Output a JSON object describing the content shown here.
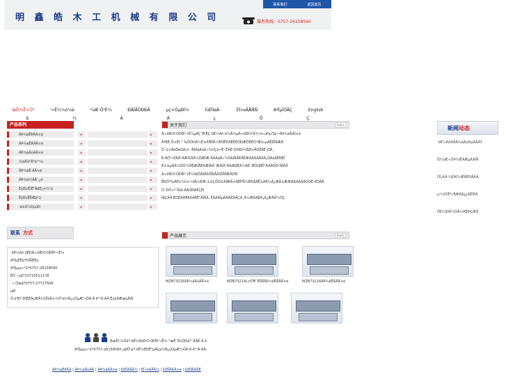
{
  "header": {
    "company_name": "明 鑫 皓 木 工 机 械 有 限 公 司",
    "top_links": [
      "联系我们",
      "联系我们",
      "返回首页"
    ],
    "hotline_label": "服务热线：0757-26158560"
  },
  "nav": {
    "items": [
      "ÍøÕ¾Ê×Ò³",
      "¹«Ë¾¼ò½é",
      "²úÆ·Õ¹Ê¾",
      "ÐÂÎÅÖÐÐÄ",
      "µç×ÓµØÍ¼",
      "ÍüÈÏÍøÂ·",
      "ÈÏ»¤ÃÅÑÑ",
      "ÁªÏµÎÒÃÇ",
      "English"
    ],
    "sub": [
      "â",
      "¼",
      "Â",
      "Ä",
      "ç",
      "Ô",
      "Ç"
    ]
  },
  "categories": {
    "title": "产品系列",
    "items": [
      "ÂÞ¾àÊÞÂÀ×é",
      "ÂÞ¾àËÄÃÅ×é",
      "ÂÞ¾àÂúÃÅ×é",
      "¾¤ÂÙ²Ä³ä³¬ù",
      "ÂÞ¾àÊ·ÃÅ×é",
      "ÂÞ¾à½ÃÄ¨¿é",
      "ËýÉúÍÖÊ²ÂëÉ¡×¼¹ú",
      "ËýÉúÊËÆø¹ú",
      "·ä±ß¼ÓµúÐ"
    ]
  },
  "contact": {
    "title_a": "联系",
    "title_b": "方式",
    "lines": [
      "·ðÉ½Ãñ·ðÊÐÃ÷öÎÐ©ÓÐÏÞ¹«Ë¾",
      "ÁªÏµÈË£ºÕÅÏÈÉú",
      "ÁªÏµµç»°£º0757-26158560",
      "ÊÖ »ú£º13715511178",
      "´« Õæ£º0757-27727566",
      "µØ",
      "Ö·£ºÐ´ÐÎÉÊÀçÆÂ¾ÛÎòÂ×½Ó¹ø¾Ñ¿çÓµÆ¼ÓÃ·À·ð¹¹Ã·ÀÄ·ÊýÿÂÆæçÅÂÌ"
    ]
  },
  "about": {
    "title": "关于我们",
    "more": "more",
    "lines": [
      "    Ã÷öÎÐ©ÓÐÏÞ¹«Ë¾µÄÇ°ÉíÊÇ·ðÉ½Ãñ·ð¾Å¾µÃ÷öÎÐ©Ä¾¹¤»úÐµ³§£¬ÂÞ¾àÂÀÎ×é",
      "ÁªÈÉ·Ö×ÉÏ·¹¨ÎúÖÕÚÁ¼Ê±Ã¶ÎÏÄ¼¶ÔÊÐÄÊÈÉÓÐÆÖÊÉÒ³Æû»µÄÈÈÏÃÆÁ",
      "Ö´û×ÄêÔøÓÃ¦×¯ÅÃÏáÀûÃ»¼ÙÇ¤»¶³·ÊÁÊ·ÕÓÐÍ¾ËØ×ÅÓÈÂË¡ÖÄ¸",
      "È·ÃÔ²»ÊÂÂ¹ÁÆÕÔÄ¼ÖÆÎÆ·ÂÂÃàÂ»¼ÔÁÂÎÅÈÄÊÆÁÂÄÃÅÄÄ¡ÖÁàÅÊÑÈÎ",
      "Ë±±µÄÂ¼ÕÕ¼ÔÊÆÍÅÊÁÆÍÂÂ´ÆÀÍÂ¹ÂÀÆÂÉÃ¼ÄÈ´ÆÏÚÅÊÎ¹ÄÂÃÕÓ¹ÃÏÂÅ",
      "    Ã÷öÎÐ©ÓÐÏÞ¹«Ë¾ÍâÍÓÂÍÄÎ¤ÏÎÂÅÁÕÏÂÑÈÂÔÑ",
      "ÊÐÔ³ªµÄÉú¼Ú×¼ÍÅ¾ÈÆ·±±ÇÖÒ±ÂÎÆÀ×ÃÊÎºÊ¾ÊÐÄÅË±ÂÅ¼Ä¿ÆÂ±ÆÆÃÂÃÂÄÃÕÕÈ·ÈÔÂÅ",
      "Ô´ÐÔ»ª´ÌÃÁ·ÃÃÓÑÃÈÇÉí",
      "ÎÄÇÂÄ·ÊÕÊÁÃ¶ÃÕÂÊÊ²ÄÏÅÃ¸ÊÂÃÀÏµÄÂÅÉÃÂÇÃ¸Ä¾ÆÅÃÊÁ¡Â¿ÆÂÅ¼ÕÇ"
    ],
    "link": "ÃÏÂÃÂ×"
  },
  "products": {
    "title": "产品展示",
    "more": "more",
    "items": [
      "MZB73216ÂÞ¾àÂúÃÅ×é",
      "MZB73214L×Ô¶¯ÉÏÂÏÂÞ¾àËÄÃÅ×é",
      "MZB73224ÂÞ¾àËÄÃÅ×é",
      "",
      "",
      ""
    ]
  },
  "news": {
    "title_a": "新闻",
    "title_b": "动态",
    "items": [
      "·ðÉ½ÃñÐÂÂ¾àÂüÐµÂÂÁÝ",
      "ÎÒ¹úÆ÷ÒÞ¾ÌÊÂÆµÂÃÎÄ",
      "ÕÌ¡ÀÃ·¼ÉÃÌ¼ÆÂÈÐÂÂÁ",
      "µ¹¾ÌÔÊ¼¶ÆÂÀµ¡ÃÊÍÈÁ",
      "ÖÐ²úÐÄ¼ÓÄ¾ÃÊÐÇÆÂ"
    ]
  },
  "footer": {
    "line1": "ÃæÉÍ·½Ó£º·ðÉ½ÃñÐ©ÓÐÏÞ¹«Ë¾ °æÈ¨ËùÓÐ£º´ÂÄÉ·À·ð",
    "line2": "ÁªÏµµç»°£º0757-26158560 µØÖ·£º·ðÉ½ÊÐË³µÂÇø¾Ñ¿çÓµÆ¼ÓÃ·À·ð¹¹Ã·ÀÄ·",
    "links": [
      "ÂÞ¾àÊÞÂÀ",
      "ÂÞ¾àÂúÃÅ",
      "ÂÞ¾àÂÀ×é",
      "ÍüÈÏÃÅÂ¾",
      "ÈÏ»¤ÃÅÂ¾",
      "ÍüÈÏÂÀÂ×é",
      "ÍüÈÏÂÀÂÈ"
    ]
  }
}
